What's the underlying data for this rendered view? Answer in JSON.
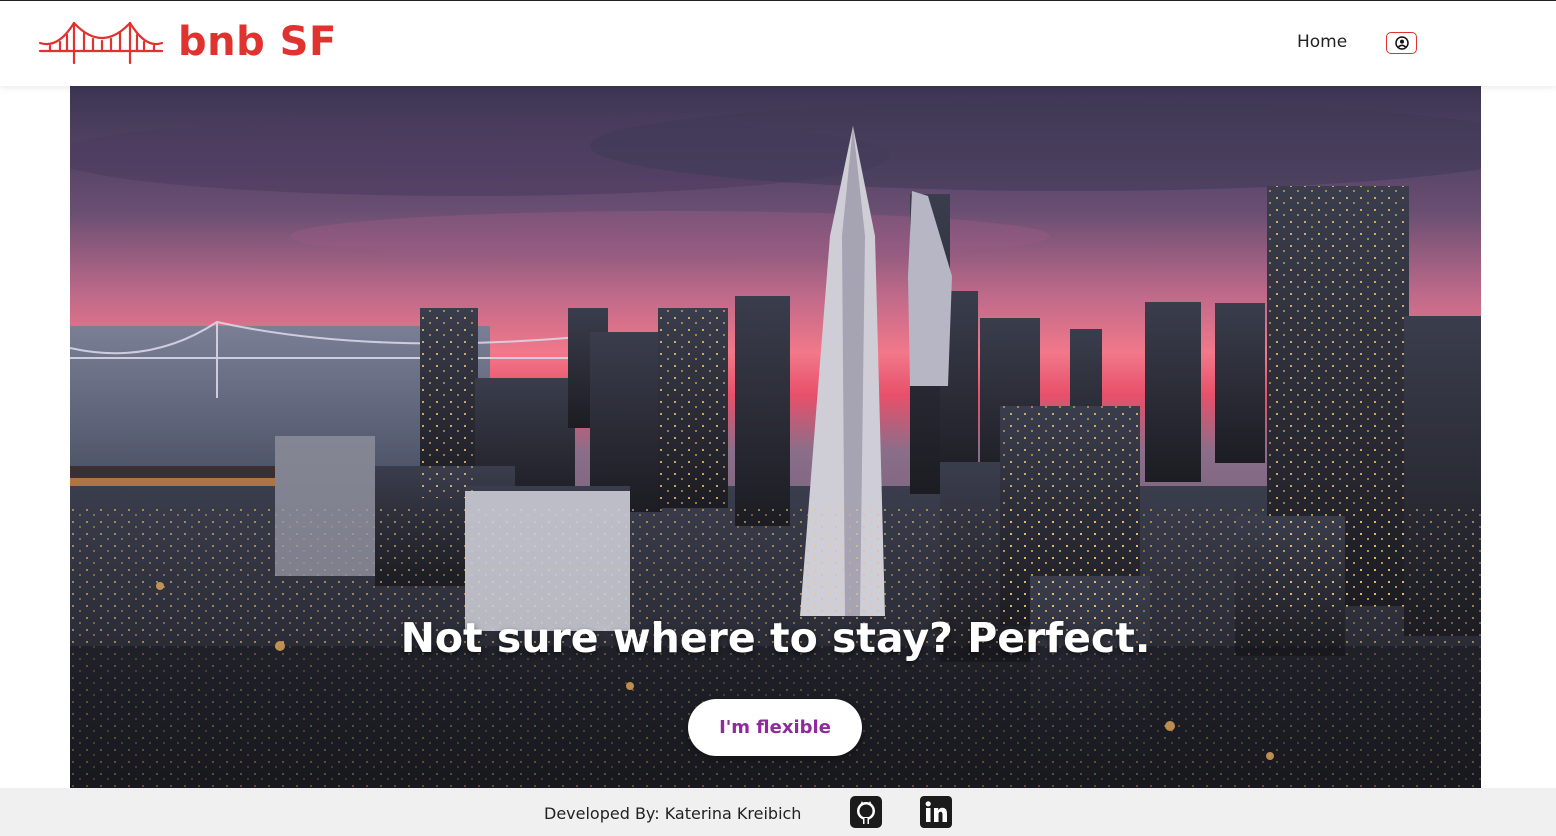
{
  "brand": {
    "name": "bnb SF",
    "logo_icon": "golden-gate-bridge-icon",
    "color": "#e0322e"
  },
  "nav": {
    "home_label": "Home",
    "profile_icon": "user-circle-icon"
  },
  "hero": {
    "title": "Not sure where to stay? Perfect.",
    "cta_label": "I'm flexible",
    "cta_color": "#8e2a9c",
    "image": "san-francisco-skyline-sunset"
  },
  "footer": {
    "credit": "Developed By: Katerina Kreibich",
    "icons": [
      "github-icon",
      "linkedin-icon"
    ]
  }
}
